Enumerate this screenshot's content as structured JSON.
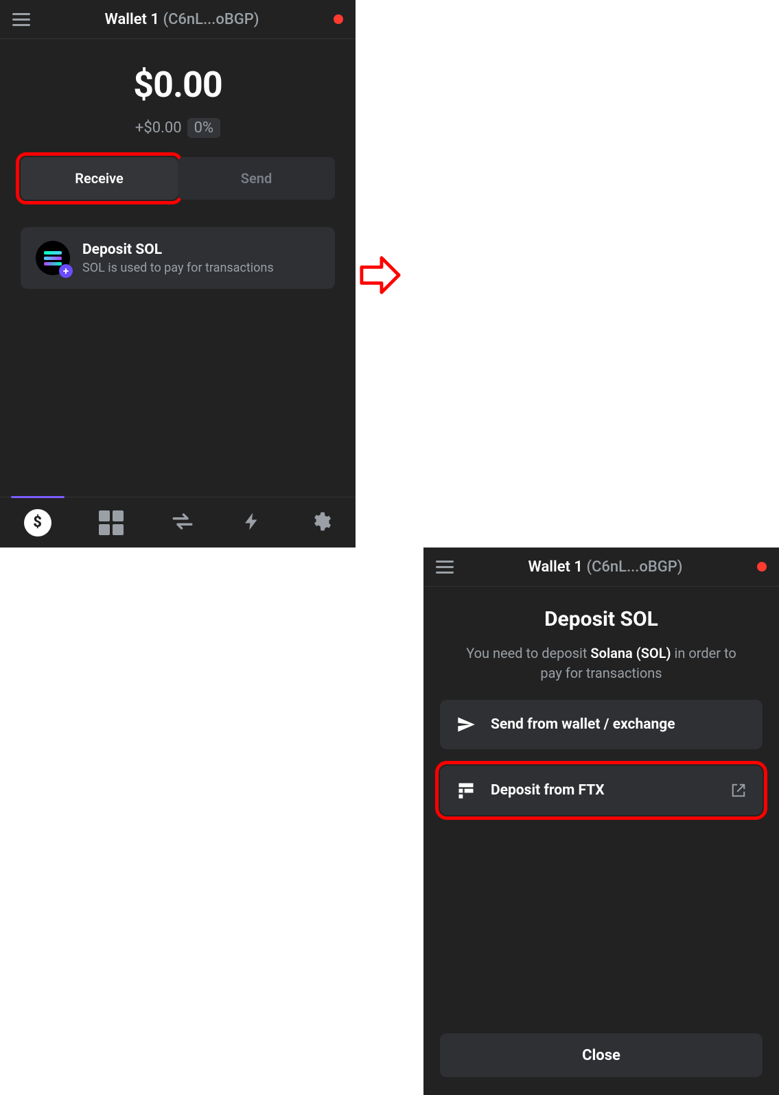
{
  "left": {
    "header": {
      "wallet_name": "Wallet 1",
      "wallet_addr": "(C6nL...oBGP)"
    },
    "balance": "$0.00",
    "balance_delta": "+$0.00",
    "balance_pct": "0%",
    "receive_label": "Receive",
    "send_label": "Send",
    "deposit": {
      "title": "Deposit SOL",
      "subtitle": "SOL is used to pay for transactions"
    }
  },
  "right": {
    "header": {
      "wallet_name": "Wallet 1",
      "wallet_addr": "(C6nL...oBGP)"
    },
    "title": "Deposit SOL",
    "instr_pre": "You need to deposit ",
    "instr_em": "Solana (SOL)",
    "instr_post": " in order to pay for transactions",
    "opt_send": "Send from wallet / exchange",
    "opt_ftx": "Deposit from FTX",
    "close_label": "Close"
  },
  "icons": {
    "dollar": "$"
  }
}
